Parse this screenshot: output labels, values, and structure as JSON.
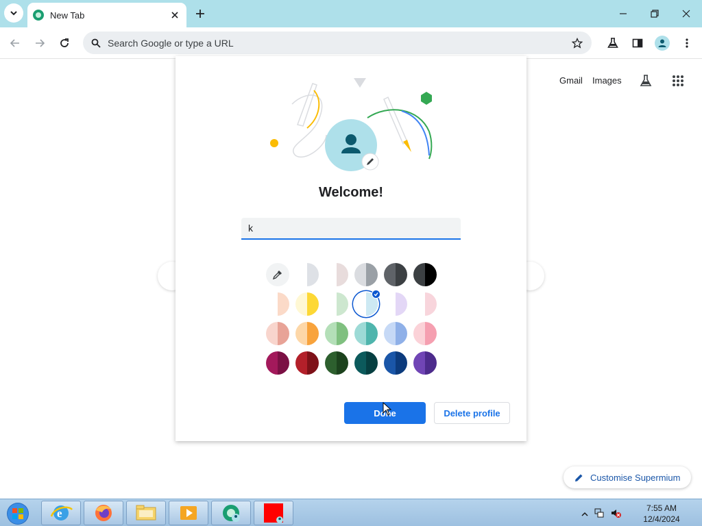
{
  "browser": {
    "tab": {
      "title": "New Tab"
    },
    "window_controls": {
      "minimize": "minimize",
      "maximize": "restore",
      "close": "close"
    },
    "omnibox": {
      "placeholder": "Search Google or type a URL"
    }
  },
  "ntp": {
    "links": [
      "Gmail",
      "Images"
    ],
    "customise_label": "Customise Supermium"
  },
  "dialog": {
    "title": "Welcome!",
    "name_value": "k",
    "done_label": "Done",
    "delete_label": "Delete profile",
    "swatches": [
      {
        "left": "#f8f9fa",
        "right": "#f8f9fa",
        "selected": false,
        "picker": true
      },
      {
        "left": "#ffffff",
        "right": "#dee1e6",
        "selected": false
      },
      {
        "left": "#ffffff",
        "right": "#e8dcdc",
        "selected": false
      },
      {
        "left": "#dadce0",
        "right": "#9aa0a6",
        "selected": false
      },
      {
        "left": "#5f6368",
        "right": "#3c4043",
        "selected": false
      },
      {
        "left": "#3c4043",
        "right": "#000000",
        "selected": false
      },
      {
        "left": "#ffffff",
        "right": "#fbdac8",
        "selected": false
      },
      {
        "left": "#fff8d4",
        "right": "#fdd835",
        "selected": false
      },
      {
        "left": "#ffffff",
        "right": "#cde7cf",
        "selected": false
      },
      {
        "left": "#ffffff",
        "right": "#cde9f3",
        "selected": true
      },
      {
        "left": "#ffffff",
        "right": "#e3d7f6",
        "selected": false
      },
      {
        "left": "#ffffff",
        "right": "#f8d5dc",
        "selected": false
      },
      {
        "left": "#f8d5cd",
        "right": "#e8a397",
        "selected": false
      },
      {
        "left": "#fdd7a8",
        "right": "#f8a33c",
        "selected": false
      },
      {
        "left": "#b4dfb8",
        "right": "#80c080",
        "selected": false
      },
      {
        "left": "#9ddad6",
        "right": "#4fb5ad",
        "selected": false
      },
      {
        "left": "#c6d9f6",
        "right": "#8fb0e8",
        "selected": false
      },
      {
        "left": "#fbd2d8",
        "right": "#f59fb0",
        "selected": false
      },
      {
        "left": "#a3195b",
        "right": "#7b1044",
        "selected": false
      },
      {
        "left": "#b3202a",
        "right": "#7e1118",
        "selected": false
      },
      {
        "left": "#2d5f2e",
        "right": "#1c421d",
        "selected": false
      },
      {
        "left": "#0c5a5c",
        "right": "#063f41",
        "selected": false
      },
      {
        "left": "#1a56a8",
        "right": "#0c3b7d",
        "selected": false
      },
      {
        "left": "#7045b5",
        "right": "#4d2b8c",
        "selected": false
      }
    ]
  },
  "taskbar": {
    "time": "7:55 AM",
    "date": "12/4/2024"
  }
}
